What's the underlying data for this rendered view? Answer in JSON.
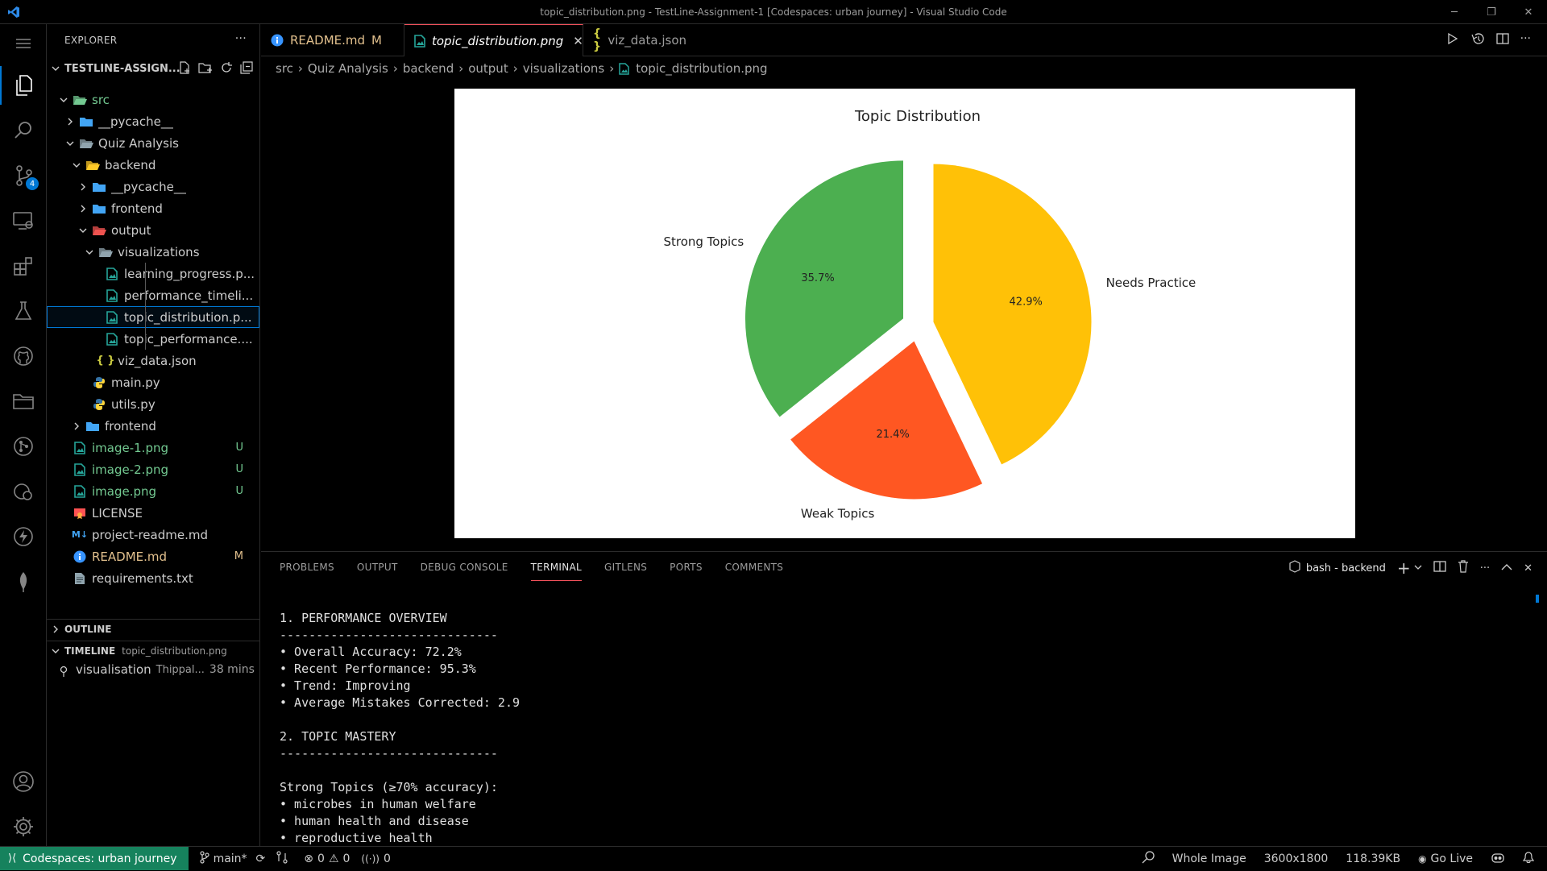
{
  "titlebar": {
    "title": "topic_distribution.png - TestLine-Assignment-1 [Codespaces: urban journey] - Visual Studio Code"
  },
  "activitybar": {
    "scm_badge": "4"
  },
  "sidebar": {
    "explorer_title": "EXPLORER",
    "root": "TESTLINE-ASSIGN...",
    "tree": [
      {
        "label": "src",
        "indent": 0,
        "type": "folder-open",
        "color": "#73c991"
      },
      {
        "label": "__pycache__",
        "indent": 1,
        "type": "folder"
      },
      {
        "label": "Quiz Analysis",
        "indent": 1,
        "type": "folder-open"
      },
      {
        "label": "backend",
        "indent": 2,
        "type": "folder-open"
      },
      {
        "label": "__pycache__",
        "indent": 3,
        "type": "folder"
      },
      {
        "label": "frontend",
        "indent": 3,
        "type": "folder"
      },
      {
        "label": "output",
        "indent": 3,
        "type": "folder-open"
      },
      {
        "label": "visualizations",
        "indent": 4,
        "type": "folder-open"
      },
      {
        "label": "learning_progress.p...",
        "indent": 5,
        "type": "image"
      },
      {
        "label": "performance_timeli...",
        "indent": 5,
        "type": "image"
      },
      {
        "label": "topic_distribution.p...",
        "indent": 5,
        "type": "image",
        "selected": true
      },
      {
        "label": "topic_performance....",
        "indent": 5,
        "type": "image"
      },
      {
        "label": "viz_data.json",
        "indent": 4,
        "type": "json"
      },
      {
        "label": "main.py",
        "indent": 3,
        "type": "python"
      },
      {
        "label": "utils.py",
        "indent": 3,
        "type": "python"
      },
      {
        "label": "frontend",
        "indent": 2,
        "type": "folder"
      },
      {
        "label": "image-1.png",
        "indent": 0,
        "type": "image",
        "badge": "U",
        "status": "untracked"
      },
      {
        "label": "image-2.png",
        "indent": 0,
        "type": "image",
        "badge": "U",
        "status": "untracked"
      },
      {
        "label": "image.png",
        "indent": 0,
        "type": "image",
        "badge": "U",
        "status": "untracked"
      },
      {
        "label": "LICENSE",
        "indent": 0,
        "type": "license"
      },
      {
        "label": "project-readme.md",
        "indent": 0,
        "type": "markdown"
      },
      {
        "label": "README.md",
        "indent": 0,
        "type": "info",
        "badge": "M",
        "status": "modified"
      },
      {
        "label": "requirements.txt",
        "indent": 0,
        "type": "text"
      }
    ],
    "outline_title": "OUTLINE",
    "timeline_title": "TIMELINE",
    "timeline_file": "topic_distribution.png",
    "timeline_entry": {
      "message": "visualisation",
      "author": "Thippal...",
      "time": "38 mins"
    }
  },
  "tabs": [
    {
      "label": "README.md",
      "badge": "M",
      "icon": "info-icon",
      "active": false
    },
    {
      "label": "topic_distribution.png",
      "icon": "image-file-icon",
      "active": true
    },
    {
      "label": "viz_data.json",
      "icon": "json-braces-icon",
      "active": false
    }
  ],
  "breadcrumb": [
    "src",
    "Quiz Analysis",
    "backend",
    "output",
    "visualizations",
    "topic_distribution.png"
  ],
  "chart_data": {
    "type": "pie",
    "title": "Topic Distribution",
    "slices": [
      {
        "label": "Needs Practice",
        "value": 42.9,
        "label_text": "42.9%",
        "color": "#ffc107"
      },
      {
        "label": "Weak Topics",
        "value": 21.4,
        "label_text": "21.4%",
        "color": "#ff5722"
      },
      {
        "label": "Strong Topics",
        "value": 35.7,
        "label_text": "35.7%",
        "color": "#4caf50"
      }
    ],
    "start_angle_deg": 90,
    "direction": "clockwise",
    "exploded": true,
    "legend": "none"
  },
  "panel": {
    "tabs": [
      "PROBLEMS",
      "OUTPUT",
      "DEBUG CONSOLE",
      "TERMINAL",
      "GITLENS",
      "PORTS",
      "COMMENTS"
    ],
    "active_tab": "TERMINAL",
    "terminal_name": "bash - backend",
    "terminal_lines": [
      "1. PERFORMANCE OVERVIEW",
      "------------------------------",
      "• Overall Accuracy: 72.2%",
      "• Recent Performance: 95.3%",
      "• Trend: Improving",
      "• Average Mistakes Corrected: 2.9",
      "",
      "2. TOPIC MASTERY",
      "------------------------------",
      "",
      "Strong Topics (≥70% accuracy):",
      "• microbes in human welfare",
      "• human health and disease",
      "• reproductive health"
    ]
  },
  "statusbar": {
    "remote": "Codespaces: urban journey",
    "branch": "main*",
    "errors": "0",
    "warnings": "0",
    "ports": "0",
    "zoom": "Whole Image",
    "dimensions": "3600x1800",
    "size": "118.39KB",
    "golive": "Go Live"
  }
}
